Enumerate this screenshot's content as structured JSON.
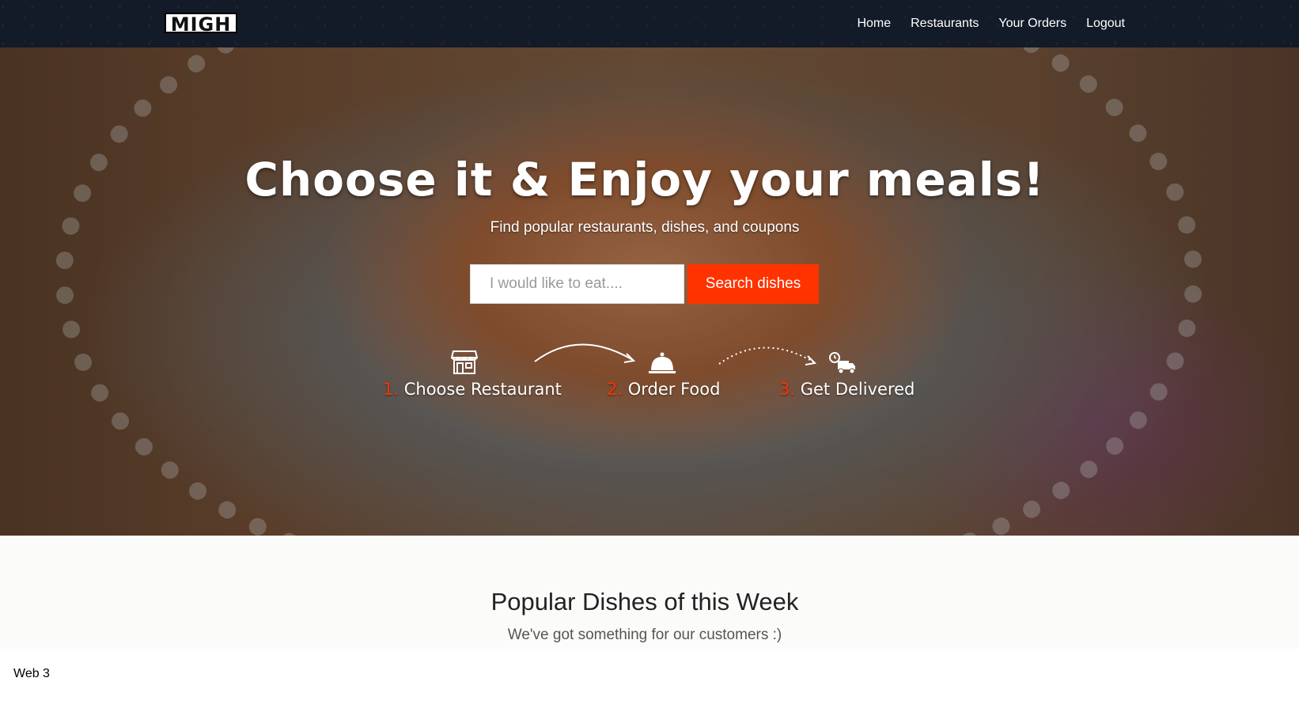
{
  "navbar": {
    "logo_text": "MIGH",
    "links": [
      {
        "label": "Home"
      },
      {
        "label": "Restaurants"
      },
      {
        "label": "Your Orders"
      },
      {
        "label": "Logout"
      }
    ]
  },
  "hero": {
    "title": "Choose it & Enjoy your meals!",
    "subtitle": "Find popular restaurants, dishes, and coupons",
    "search": {
      "placeholder": "I would like to eat....",
      "value": "",
      "button_label": "Search dishes"
    },
    "steps": [
      {
        "number": "1.",
        "label": "Choose Restaurant",
        "icon": "storefront-icon"
      },
      {
        "number": "2.",
        "label": "Order Food",
        "icon": "food-cloche-icon"
      },
      {
        "number": "3.",
        "label": "Get Delivered",
        "icon": "delivery-truck-icon"
      }
    ]
  },
  "popular": {
    "title": "Popular Dishes of this Week",
    "subtitle": "We've got something for our customers :)"
  },
  "caption": "Web 3",
  "colors": {
    "navbar_bg": "#131a28",
    "accent": "#ff3300",
    "section_bg": "#fbfbfa"
  }
}
